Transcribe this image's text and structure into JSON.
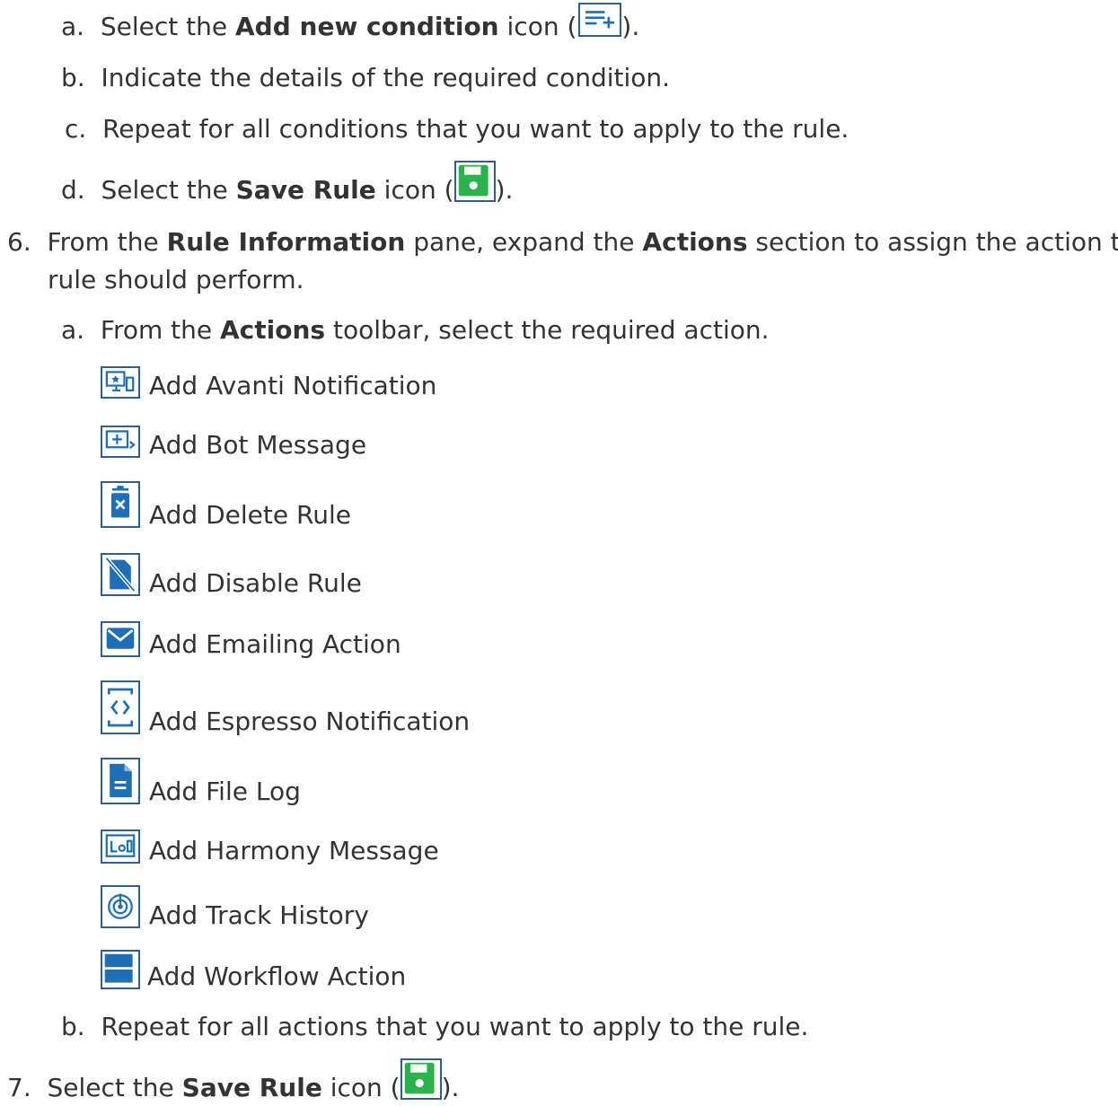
{
  "steps": {
    "s5a": {
      "marker": "a.",
      "before": "Select the ",
      "bold": "Add new condition",
      "after": " icon (",
      "end": ")."
    },
    "s5b": {
      "marker": "b.",
      "text": "Indicate the details of the required condition."
    },
    "s5c": {
      "marker": "c.",
      "text": "Repeat for all conditions that you want to apply to the rule."
    },
    "s5d": {
      "marker": "d.",
      "before": "Select the ",
      "bold": "Save Rule",
      "after": " icon (",
      "end": ")."
    },
    "s6": {
      "marker": "6.",
      "part1": "From the ",
      "bold1": "Rule Information",
      "part2": " pane, expand the ",
      "bold2": "Actions",
      "part3": " section to assign the action the",
      "line2": "rule should perform."
    },
    "s6a": {
      "marker": "a.",
      "before": "From the ",
      "bold": "Actions",
      "after": " toolbar, select the required action."
    },
    "s6b": {
      "marker": "b.",
      "text": "Repeat for all actions that you want to apply to the rule."
    },
    "s7": {
      "marker": "7.",
      "before": "Select the ",
      "bold": "Save Rule",
      "after": " icon (",
      "end": ")."
    }
  },
  "actions": [
    {
      "label": "Add Avanti Notification",
      "icon": "avanti-notification-icon"
    },
    {
      "label": "Add Bot Message",
      "icon": "bot-message-icon"
    },
    {
      "label": "Add Delete Rule",
      "icon": "delete-rule-icon"
    },
    {
      "label": "Add Disable Rule",
      "icon": "disable-rule-icon"
    },
    {
      "label": "Add Emailing Action",
      "icon": "emailing-action-icon"
    },
    {
      "label": "Add Espresso Notification",
      "icon": "espresso-notification-icon"
    },
    {
      "label": "Add File Log",
      "icon": "file-log-icon"
    },
    {
      "label": "Add Harmony Message",
      "icon": "harmony-message-icon"
    },
    {
      "label": "Add Track History",
      "icon": "track-history-icon"
    },
    {
      "label": "Add Workflow Action",
      "icon": "workflow-action-icon"
    }
  ],
  "colors": {
    "text": "#333333",
    "icon_blue": "#1f6fb5",
    "save_green": "#2bb24c"
  }
}
